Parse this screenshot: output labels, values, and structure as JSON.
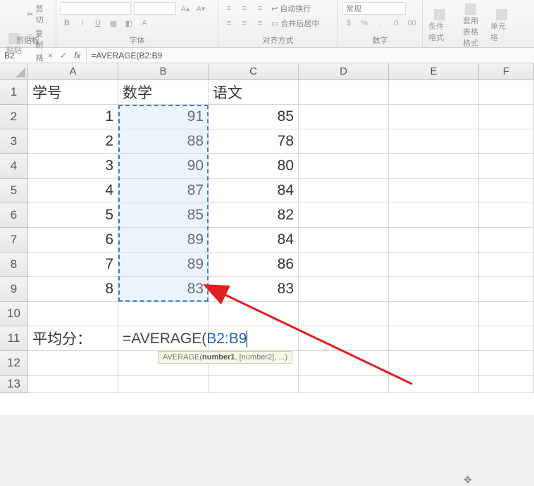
{
  "ribbon": {
    "clipboard": {
      "paste": "粘贴",
      "cut": "剪切",
      "copy": "复制",
      "format_painter": "格式刷",
      "group_label": "剪贴板"
    },
    "font": {
      "group_label": "字体",
      "bold": "B",
      "italic": "I",
      "underline": "U"
    },
    "alignment": {
      "wrap": "自动换行",
      "merge": "合并后居中",
      "group_label": "对齐方式"
    },
    "number": {
      "format": "常规",
      "group_label": "数字"
    },
    "styles": {
      "cond": "条件格式",
      "table": "套用\n表格格式",
      "cell": "单元格"
    }
  },
  "formula_bar": {
    "name_box": "B2",
    "cancel": "×",
    "confirm": "✓",
    "fx": "fx",
    "formula": "=AVERAGE(B2:B9"
  },
  "columns": [
    "A",
    "B",
    "C",
    "D",
    "E",
    "F"
  ],
  "rows": [
    "1",
    "2",
    "3",
    "4",
    "5",
    "6",
    "7",
    "8",
    "9",
    "10",
    "11",
    "12",
    "13"
  ],
  "data": {
    "headers": {
      "A": "学号",
      "B": "数学",
      "C": "语文"
    },
    "body": [
      {
        "A": "1",
        "B": "91",
        "C": "85"
      },
      {
        "A": "2",
        "B": "88",
        "C": "78"
      },
      {
        "A": "3",
        "B": "90",
        "C": "80"
      },
      {
        "A": "4",
        "B": "87",
        "C": "84"
      },
      {
        "A": "5",
        "B": "85",
        "C": "82"
      },
      {
        "A": "6",
        "B": "89",
        "C": "84"
      },
      {
        "A": "7",
        "B": "89",
        "C": "86"
      },
      {
        "A": "8",
        "B": "83",
        "C": "83"
      }
    ],
    "avg_label": "平均分："
  },
  "formula_cell": {
    "prefix": "=AVERAGE(",
    "range": "B2:B9"
  },
  "tooltip": {
    "func": "AVERAGE(",
    "arg1": "number1",
    "rest": ", [number2], ...)"
  },
  "chart_data": {
    "type": "table",
    "columns": [
      "学号",
      "数学",
      "语文"
    ],
    "rows": [
      [
        1,
        91,
        85
      ],
      [
        2,
        88,
        78
      ],
      [
        3,
        90,
        80
      ],
      [
        4,
        87,
        84
      ],
      [
        5,
        85,
        82
      ],
      [
        6,
        89,
        84
      ],
      [
        7,
        89,
        86
      ],
      [
        8,
        83,
        83
      ]
    ],
    "formula": "=AVERAGE(B2:B9)",
    "formula_target": "B11",
    "row_label_11": "平均分："
  }
}
